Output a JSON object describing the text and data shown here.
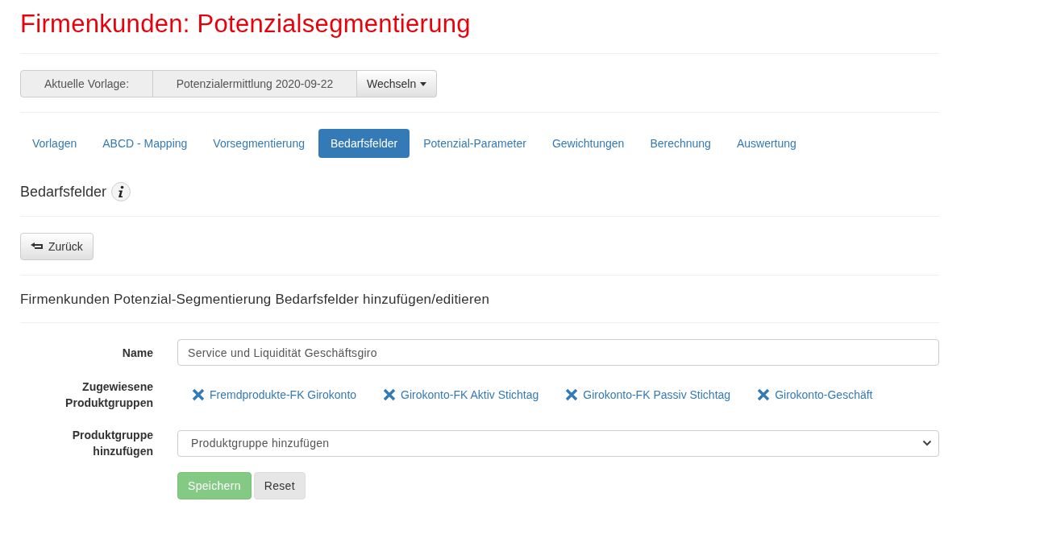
{
  "title": "Firmenkunden: Potenzialsegmentierung",
  "template_bar": {
    "label": "Aktuelle Vorlage:",
    "value": "Potenzialermittlung 2020-09-22",
    "switch_button": "Wechseln"
  },
  "tabs": [
    {
      "label": "Vorlagen",
      "selected": false
    },
    {
      "label": "ABCD - Mapping",
      "selected": false
    },
    {
      "label": "Vorsegmentierung",
      "selected": false
    },
    {
      "label": "Bedarfsfelder",
      "selected": true
    },
    {
      "label": "Potenzial-Parameter",
      "selected": false
    },
    {
      "label": "Gewichtungen",
      "selected": false
    },
    {
      "label": "Berechnung",
      "selected": false
    },
    {
      "label": "Auswertung",
      "selected": false
    }
  ],
  "section_heading": "Bedarfsfelder",
  "back_button": "Zurück",
  "form_heading": "Firmenkunden Potenzial-Segmentierung Bedarfsfelder hinzufügen/editieren",
  "form": {
    "name_label": "Name",
    "name_value": "Service und Liquidität Geschäftsgiro",
    "assigned_label": "Zugewiesene Produktgruppen",
    "assigned_groups": [
      "Fremdprodukte-FK Girokonto",
      "Girokonto-FK Aktiv Stichtag",
      "Girokonto-FK Passiv Stichtag",
      "Girokonto-Geschäft"
    ],
    "add_label": "Produktgruppe hinzufügen",
    "add_select": "Produktgruppe hinzufügen"
  },
  "buttons": [
    {
      "label": "Speichern",
      "kind": "primary",
      "disabled": true
    },
    {
      "label": "Reset",
      "kind": "default",
      "disabled": false
    }
  ]
}
